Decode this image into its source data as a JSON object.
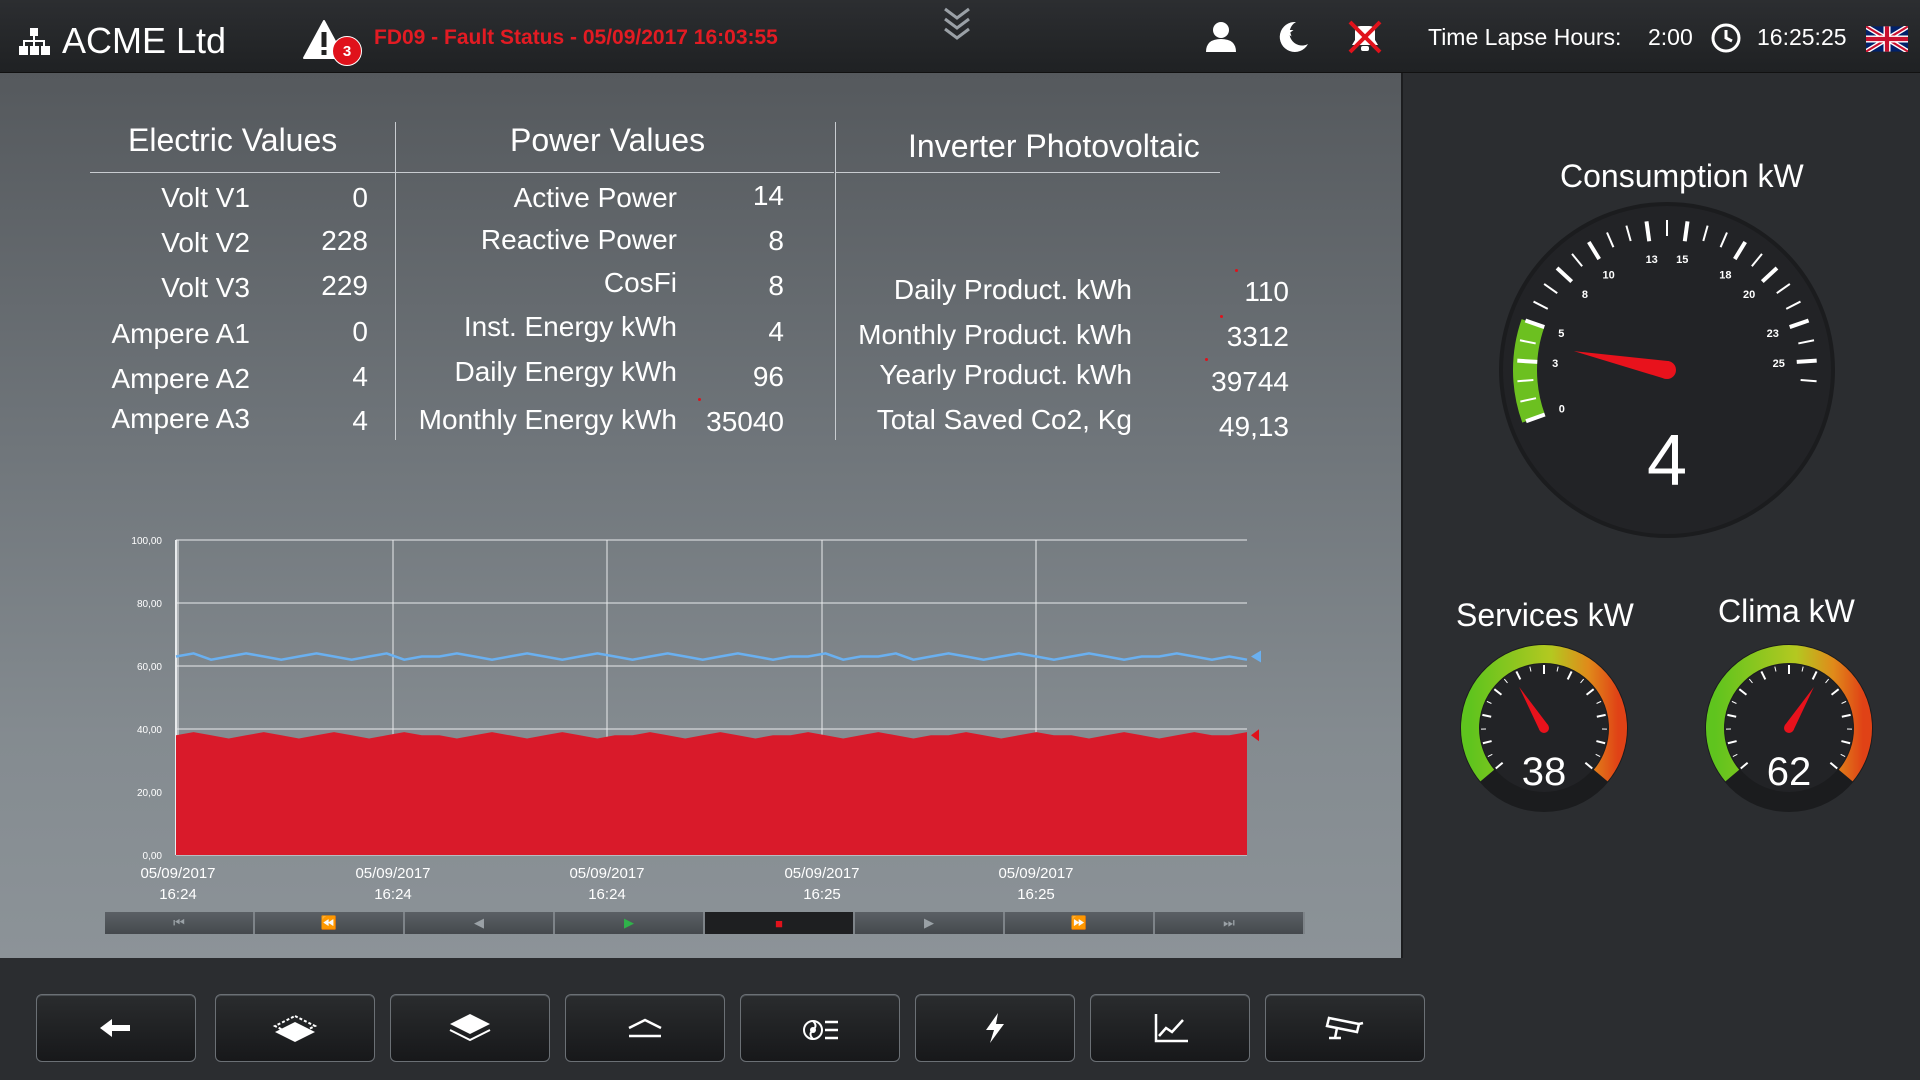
{
  "header": {
    "title": "ACME Ltd",
    "alert_count": "3",
    "fault_status": "FD09 - Fault Status - 05/09/2017 16:03:55",
    "time_lapse_label": "Time Lapse Hours:",
    "time_lapse_value": "2:00",
    "clock_time": "16:25:25",
    "icons": [
      "network-icon",
      "warning-icon",
      "expand-down-icon",
      "user-icon",
      "night-mode-icon",
      "alarm-mute-icon",
      "clock-icon",
      "uk-flag-icon"
    ]
  },
  "electric": {
    "title": "Electric Values",
    "rows": [
      {
        "label": "Volt V1",
        "value": "0"
      },
      {
        "label": "Volt V2",
        "value": "228"
      },
      {
        "label": "Volt V3",
        "value": "229"
      },
      {
        "label": "Ampere A1",
        "value": "0"
      },
      {
        "label": "Ampere A2",
        "value": "4"
      },
      {
        "label": "Ampere A3",
        "value": "4"
      }
    ]
  },
  "power": {
    "title": "Power Values",
    "rows": [
      {
        "label": "Active Power",
        "value": "14"
      },
      {
        "label": "Reactive Power",
        "value": "8"
      },
      {
        "label": "CosFi",
        "value": "8"
      },
      {
        "label": "Inst. Energy kWh",
        "value": "4"
      },
      {
        "label": "Daily Energy kWh",
        "value": "96"
      },
      {
        "label": "Monthly Energy kWh",
        "value": "35040"
      }
    ]
  },
  "inverter": {
    "title": "Inverter Photovoltaic",
    "rows": [
      {
        "label": "Daily Product. kWh",
        "value": "110"
      },
      {
        "label": "Monthly Product. kWh",
        "value": "3312"
      },
      {
        "label": "Yearly Product. kWh",
        "value": "39744"
      },
      {
        "label": "Total Saved Co2, Kg",
        "value": "49,13"
      }
    ]
  },
  "chart_data": {
    "type": "area",
    "ylim": [
      0,
      100
    ],
    "y_ticks": [
      "0,00",
      "20,00",
      "40,00",
      "60,00",
      "80,00",
      "100,00"
    ],
    "x_labels": [
      {
        "date": "05/09/2017",
        "time": "16:24"
      },
      {
        "date": "05/09/2017",
        "time": "16:24"
      },
      {
        "date": "05/09/2017",
        "time": "16:24"
      },
      {
        "date": "05/09/2017",
        "time": "16:25"
      },
      {
        "date": "05/09/2017",
        "time": "16:25"
      }
    ],
    "series": [
      {
        "color": "#6ab0f0",
        "kind": "line",
        "approx_level": 63,
        "values": [
          63,
          64,
          62,
          63,
          64,
          63,
          62,
          63,
          64,
          63,
          62,
          63,
          64,
          62,
          63,
          63,
          64,
          63,
          62,
          63,
          64,
          63,
          62,
          63,
          64,
          63,
          62,
          63,
          64,
          63,
          62,
          63,
          64,
          63,
          62,
          63,
          63,
          64,
          62,
          63,
          63,
          64,
          62,
          63,
          64,
          63,
          62,
          63,
          64,
          63,
          62,
          63,
          64,
          63,
          62,
          63,
          63,
          64,
          63,
          62,
          63,
          62
        ]
      },
      {
        "color": "#d91a2a",
        "kind": "area",
        "approx_level": 38,
        "values": [
          38,
          39,
          38,
          37,
          38,
          39,
          38,
          37,
          38,
          39,
          38,
          37,
          38,
          39,
          38,
          38,
          37,
          38,
          39,
          38,
          37,
          38,
          39,
          38,
          37,
          38,
          38,
          39,
          38,
          37,
          38,
          39,
          38,
          37,
          38,
          38,
          39,
          38,
          37,
          38,
          39,
          38,
          37,
          38,
          38,
          39,
          38,
          37,
          38,
          39,
          38,
          38,
          37,
          38,
          39,
          38,
          37,
          38,
          39,
          38,
          38,
          39
        ]
      }
    ],
    "playback_controls": [
      "skip-to-start",
      "fast-rewind",
      "step-back",
      "play",
      "stop",
      "step-forward",
      "fast-forward",
      "skip-to-end"
    ],
    "playback_state": "stop"
  },
  "gauges": {
    "consumption": {
      "title": "Consumption kW",
      "value": "4",
      "numeric": 4,
      "max": 28,
      "ticks": [
        "0",
        "3",
        "5",
        "8",
        "10",
        "13",
        "15",
        "18",
        "20",
        "23",
        "25"
      ]
    },
    "services": {
      "title": "Services kW",
      "value": "38",
      "numeric": 38,
      "max": 100
    },
    "clima": {
      "title": "Clima kW",
      "value": "62",
      "numeric": 62,
      "max": 100
    }
  },
  "toolbar": {
    "buttons": [
      "back-arrow-icon",
      "floor-plan-icon",
      "layers-icon",
      "roof-icon",
      "fan-coil-icon",
      "lightning-icon",
      "trend-chart-icon",
      "cctv-camera-icon"
    ]
  },
  "colors": {
    "accent_red": "#e31b23",
    "line_blue": "#6ab0f0",
    "area_red": "#d91a2a",
    "gauge_green": "#6cc020"
  }
}
